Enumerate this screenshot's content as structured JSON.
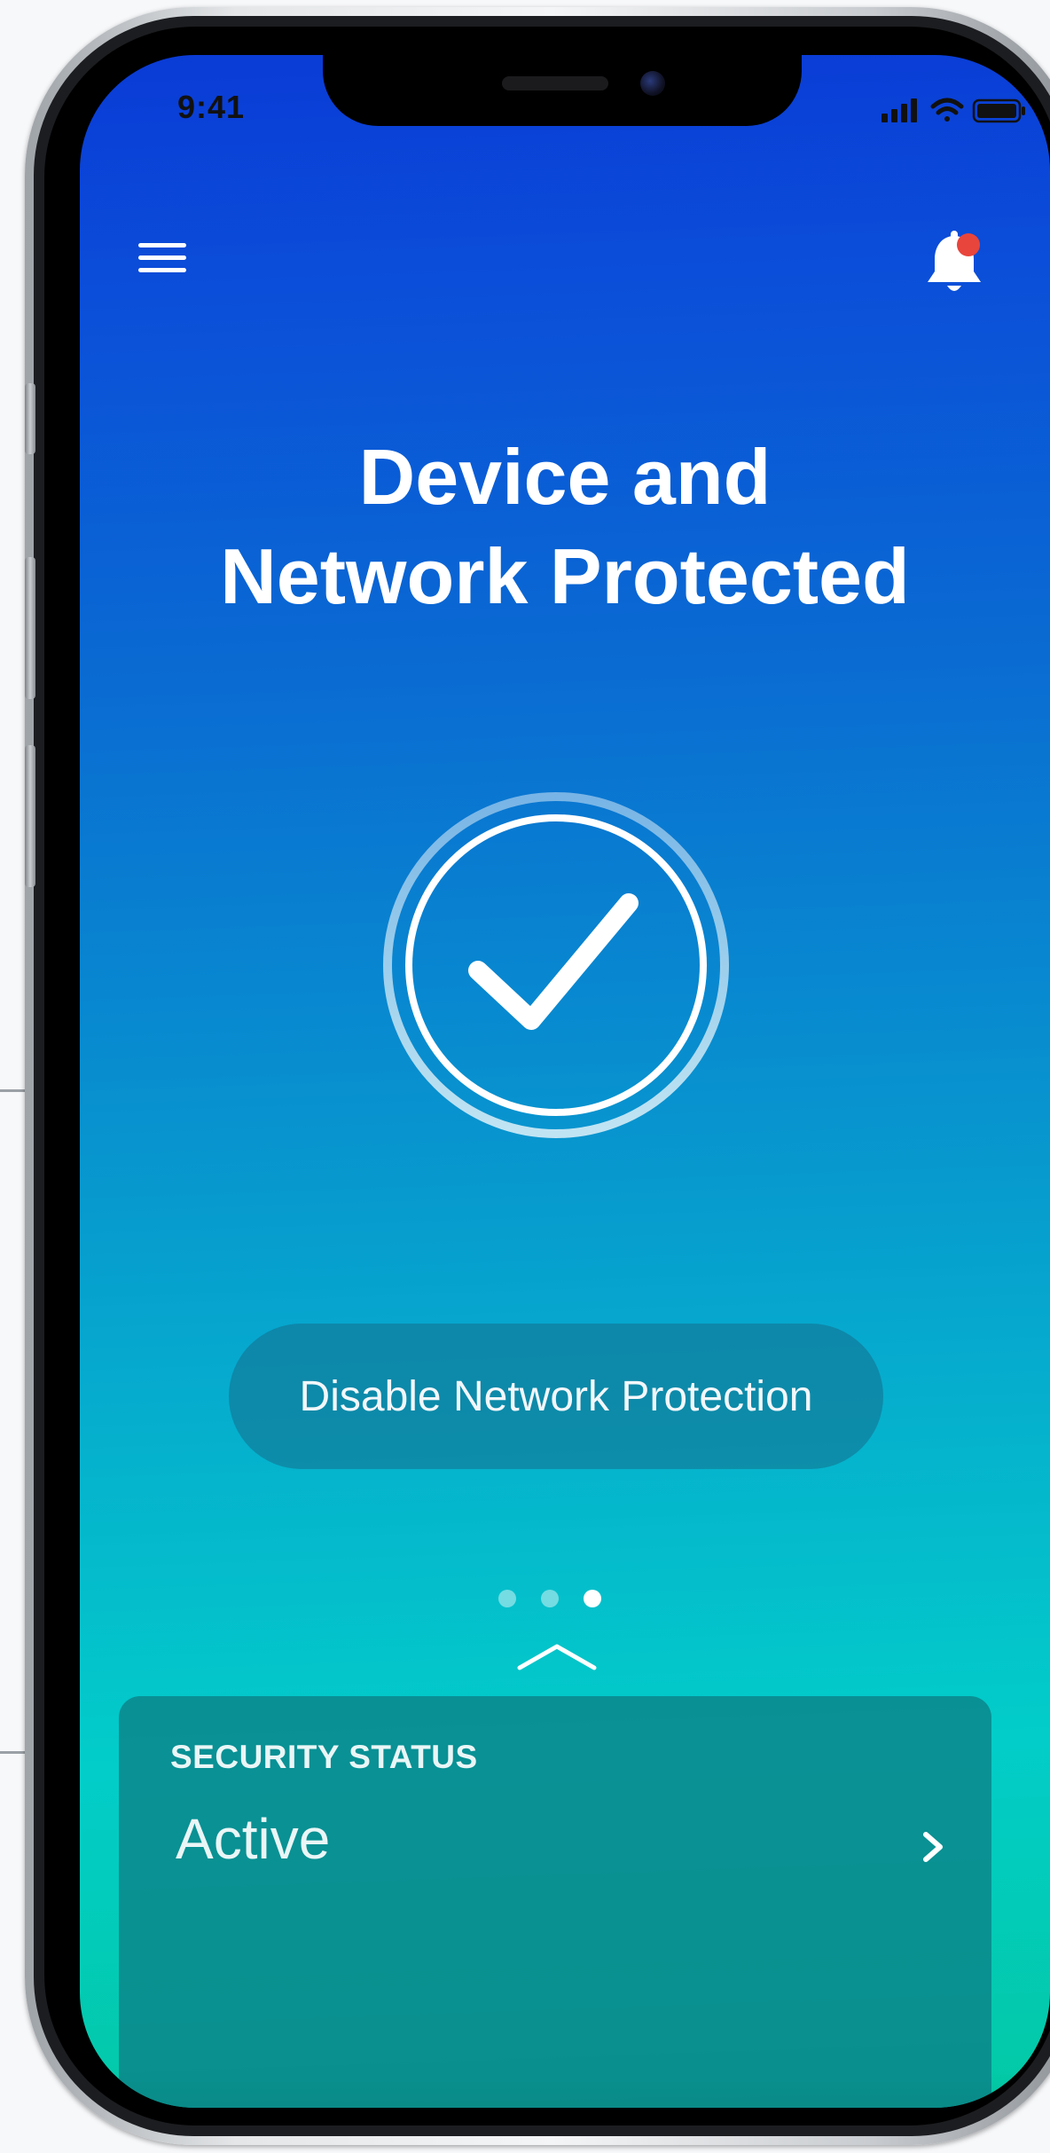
{
  "status_bar": {
    "time": "9:41",
    "icons": [
      "signal-icon",
      "wifi-icon",
      "battery-icon"
    ]
  },
  "header": {
    "menu_icon": "hamburger-menu-icon",
    "notification_icon": "bell-icon",
    "notification_badge_color": "#e8453c"
  },
  "hero": {
    "title_line1": "Device and",
    "title_line2": "Network Protected",
    "status_icon": "checkmark-circle-icon"
  },
  "actions": {
    "disable_label": "Disable Network Protection"
  },
  "pager": {
    "count": 3,
    "active_index": 2
  },
  "status_card": {
    "label": "SECURITY STATUS",
    "value": "Active",
    "chevron_icon": "chevron-right-icon",
    "expand_icon": "chevron-up-icon"
  },
  "colors": {
    "gradient_top": "#0a3bd6",
    "gradient_bottom": "#03c9a4",
    "text": "#ffffff",
    "badge": "#e8453c"
  }
}
